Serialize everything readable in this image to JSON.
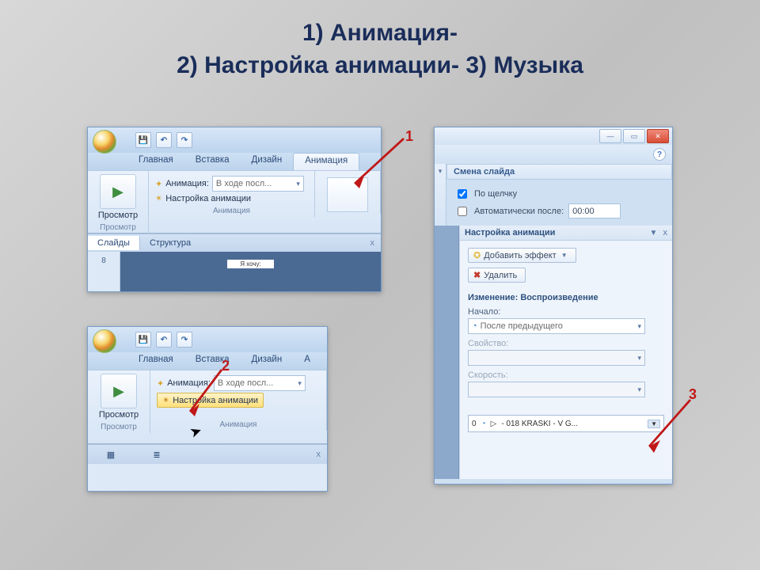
{
  "title_line1": "1) Анимация-",
  "title_line2": "2) Настройка анимации- 3) Музыка",
  "annotations": {
    "n1": "1",
    "n2": "2",
    "n3": "3"
  },
  "qat": {
    "save": "💾",
    "undo": "↶",
    "redo": "↷"
  },
  "tabs": {
    "home": "Главная",
    "insert": "Вставка",
    "design": "Дизайн",
    "anim": "Анимация",
    "anim_short": "А"
  },
  "ribbon": {
    "preview": "Просмотр",
    "preview_group": "Просмотр",
    "anim_label": "Анимация:",
    "anim_value": "В ходе посл...",
    "custom_anim": "Настройка анимации",
    "anim_group": "Анимация"
  },
  "tabs2": {
    "slides": "Слайды",
    "structure": "Структура",
    "close": "x"
  },
  "p1_footer": "Я хочу:",
  "right": {
    "help": "?",
    "transition_header": "Смена слайда",
    "on_click": "По щелчку",
    "auto_after": "Автоматически после:",
    "auto_value": "00:00",
    "pane_title": "Настройка анимации",
    "pin": "▼",
    "close": "x",
    "add_effect": "Добавить эффект",
    "remove": "Удалить",
    "change_header": "Изменение: Воспроизведение",
    "start_label": "Начало:",
    "start_value": "После предыдущего",
    "property_label": "Свойство:",
    "speed_label": "Скорость:",
    "media_index": "0",
    "media_name": "- 018 KRASKI - V G..."
  }
}
